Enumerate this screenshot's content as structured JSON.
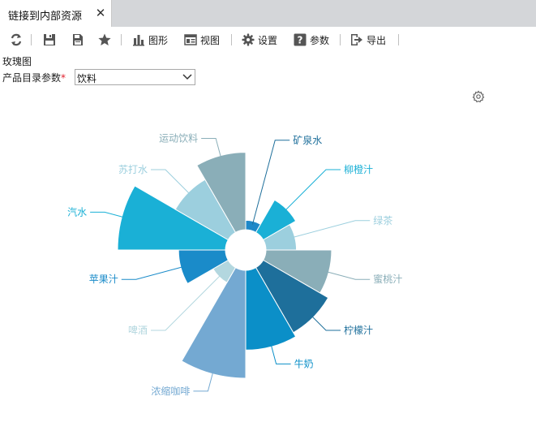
{
  "tab": {
    "title": "链接到内部资源",
    "close": "✕"
  },
  "toolbar": {
    "refresh_icon": "refresh-icon",
    "save_icon": "save-icon",
    "save_as_icon": "save-as-icon",
    "favorite_icon": "star-icon",
    "chart_label": "图形",
    "view_label": "视图",
    "settings_label": "设置",
    "params_label": "参数",
    "export_label": "导出"
  },
  "report": {
    "chart_name": "玫瑰图",
    "param_label": "产品目录参数",
    "param_required": "*",
    "param_value": "饮料"
  },
  "colors": {
    "accent": "#1b5e9e",
    "required": "#e0202c"
  },
  "chart_data": {
    "type": "rose",
    "title": "",
    "categories": [
      "矿泉水",
      "柳橙汁",
      "绿茶",
      "蜜桃汁",
      "柠檬汁",
      "牛奶",
      "浓缩咖啡",
      "啤酒",
      "苹果汁",
      "汽水",
      "苏打水",
      "运动饮料"
    ],
    "values": [
      0.2,
      0.8,
      0.65,
      1.4,
      1.6,
      1.7,
      2.3,
      0.37,
      1.0,
      2.3,
      1.3,
      1.65
    ],
    "colors": [
      "#1e88c8",
      "#1ab0d6",
      "#9ccfde",
      "#8aaeb8",
      "#1e6f9b",
      "#0b8fc8",
      "#74a9d2",
      "#b3d7df",
      "#1a8bc9",
      "#1ab0d6",
      "#9ccfde",
      "#8aaeb8"
    ],
    "label_colors": [
      "#1e6f9b",
      "#1ab0d6",
      "#9ccfde",
      "#8aaeb8",
      "#1e6f9b",
      "#0b8fc8",
      "#74a9d2",
      "#b3d7df",
      "#1a8bc9",
      "#1ab0d6",
      "#9ccfde",
      "#8aaeb8"
    ],
    "inner_hole": true,
    "legend": "none"
  }
}
